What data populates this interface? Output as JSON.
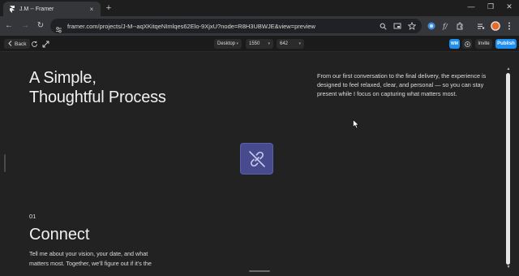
{
  "browser": {
    "tab": {
      "title": "J.M -- Framer",
      "favicon_icon": "framer-logo-icon",
      "close_glyph": "×"
    },
    "new_tab_glyph": "+",
    "window_controls": {
      "minimize": "—",
      "restore": "❐",
      "close": "✕"
    },
    "nav": {
      "back": "←",
      "forward": "→",
      "reload": "↻"
    },
    "url": "framer.com/projects/J-M--aqXKitqeNImlqes62Elo-9XjxU?node=R8H3UBWJE&view=preview",
    "omnibox_icons": [
      "search-icon",
      "cast-icon",
      "bookmark-star-icon"
    ],
    "extension_icons": [
      "extension-blue-icon",
      "extension-script-icon",
      "puzzle-icon",
      "media-icon",
      "split-icon",
      "profile-avatar",
      "menu-kebab-icon"
    ]
  },
  "framer": {
    "back_label": "Back",
    "device": "Desktop",
    "width": "1550",
    "height": "642",
    "wm_label": "WM",
    "invite_label": "Invite",
    "publish_label": "Publish",
    "accent": "#1f8ef1"
  },
  "page": {
    "headline_line1": "A Simple,",
    "headline_line2": "Thoughtful Process",
    "intro": "From our first conversation to the final delivery, the experience is designed to feel relaxed, clear, and personal — so you can stay present while I focus on capturing what matters most.",
    "center_icon": "broken-link-icon",
    "center_icon_color": "#474b8e",
    "step_number": "01",
    "step_title": "Connect",
    "step_description": "Tell me about your vision, your date, and what matters most. Together, we'll figure out if it's the"
  }
}
